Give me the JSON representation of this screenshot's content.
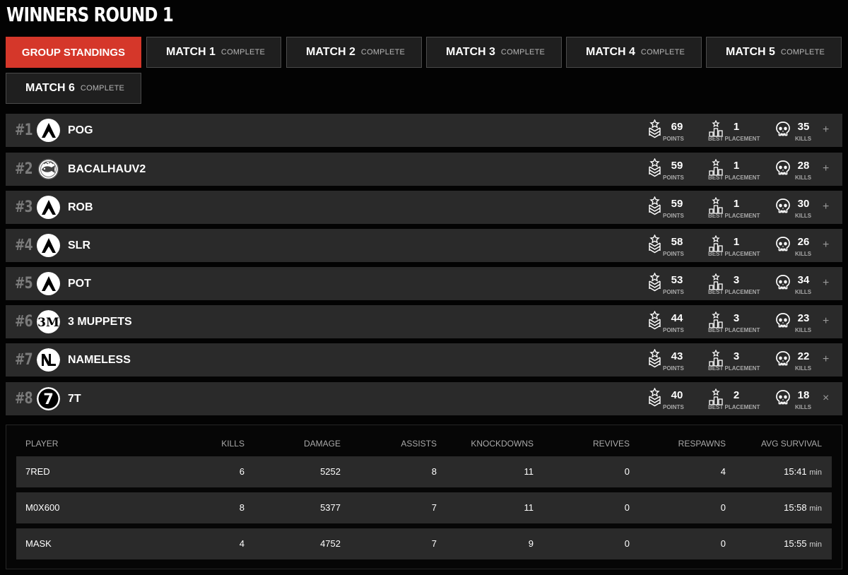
{
  "page": {
    "title": "WINNERS ROUND 1"
  },
  "tabs": [
    {
      "name": "GROUP STANDINGS",
      "status": "",
      "active": true
    },
    {
      "name": "MATCH 1",
      "status": "COMPLETE"
    },
    {
      "name": "MATCH 2",
      "status": "COMPLETE"
    },
    {
      "name": "MATCH 3",
      "status": "COMPLETE"
    },
    {
      "name": "MATCH 4",
      "status": "COMPLETE"
    },
    {
      "name": "MATCH 5",
      "status": "COMPLETE"
    },
    {
      "name": "MATCH 6",
      "status": "COMPLETE"
    }
  ],
  "stat_labels": {
    "points": "POINTS",
    "best": "BEST PLACEMENT",
    "kills": "KILLS"
  },
  "teams": [
    {
      "rank": "#1",
      "name": "POG",
      "logo": "apex-logo",
      "points": "69",
      "best": "1",
      "kills": "35",
      "toggle": "+"
    },
    {
      "rank": "#2",
      "name": "BACALHAUV2",
      "logo": "fish-crest-logo",
      "points": "59",
      "best": "1",
      "kills": "28",
      "toggle": "+"
    },
    {
      "rank": "#3",
      "name": "ROB",
      "logo": "apex-logo",
      "points": "59",
      "best": "1",
      "kills": "30",
      "toggle": "+"
    },
    {
      "rank": "#4",
      "name": "SLR",
      "logo": "apex-logo",
      "points": "58",
      "best": "1",
      "kills": "26",
      "toggle": "+"
    },
    {
      "rank": "#5",
      "name": "POT",
      "logo": "apex-logo",
      "points": "53",
      "best": "3",
      "kills": "34",
      "toggle": "+"
    },
    {
      "rank": "#6",
      "name": "3 MUPPETS",
      "logo": "3m-logo",
      "points": "44",
      "best": "3",
      "kills": "23",
      "toggle": "+"
    },
    {
      "rank": "#7",
      "name": "NAMELESS",
      "logo": "nl-logo",
      "points": "43",
      "best": "3",
      "kills": "22",
      "toggle": "+"
    },
    {
      "rank": "#8",
      "name": "7T",
      "logo": "7-logo",
      "points": "40",
      "best": "2",
      "kills": "18",
      "toggle": "×"
    }
  ],
  "player_table": {
    "columns": [
      "PLAYER",
      "KILLS",
      "DAMAGE",
      "ASSISTS",
      "KNOCKDOWNS",
      "REVIVES",
      "RESPAWNS",
      "AVG SURVIVAL"
    ],
    "rows": [
      {
        "player": "7RED",
        "kills": "6",
        "damage": "5252",
        "assists": "8",
        "knockdowns": "11",
        "revives": "0",
        "respawns": "4",
        "survival": "15:41",
        "unit": "min"
      },
      {
        "player": "M0X600",
        "kills": "8",
        "damage": "5377",
        "assists": "7",
        "knockdowns": "11",
        "revives": "0",
        "respawns": "0",
        "survival": "15:58",
        "unit": "min"
      },
      {
        "player": "MASK",
        "kills": "4",
        "damage": "4752",
        "assists": "7",
        "knockdowns": "9",
        "revives": "0",
        "respawns": "0",
        "survival": "15:55",
        "unit": "min"
      }
    ]
  },
  "icons": {
    "points": "medal-icon",
    "best": "podium-icon",
    "kills": "skull-icon"
  }
}
